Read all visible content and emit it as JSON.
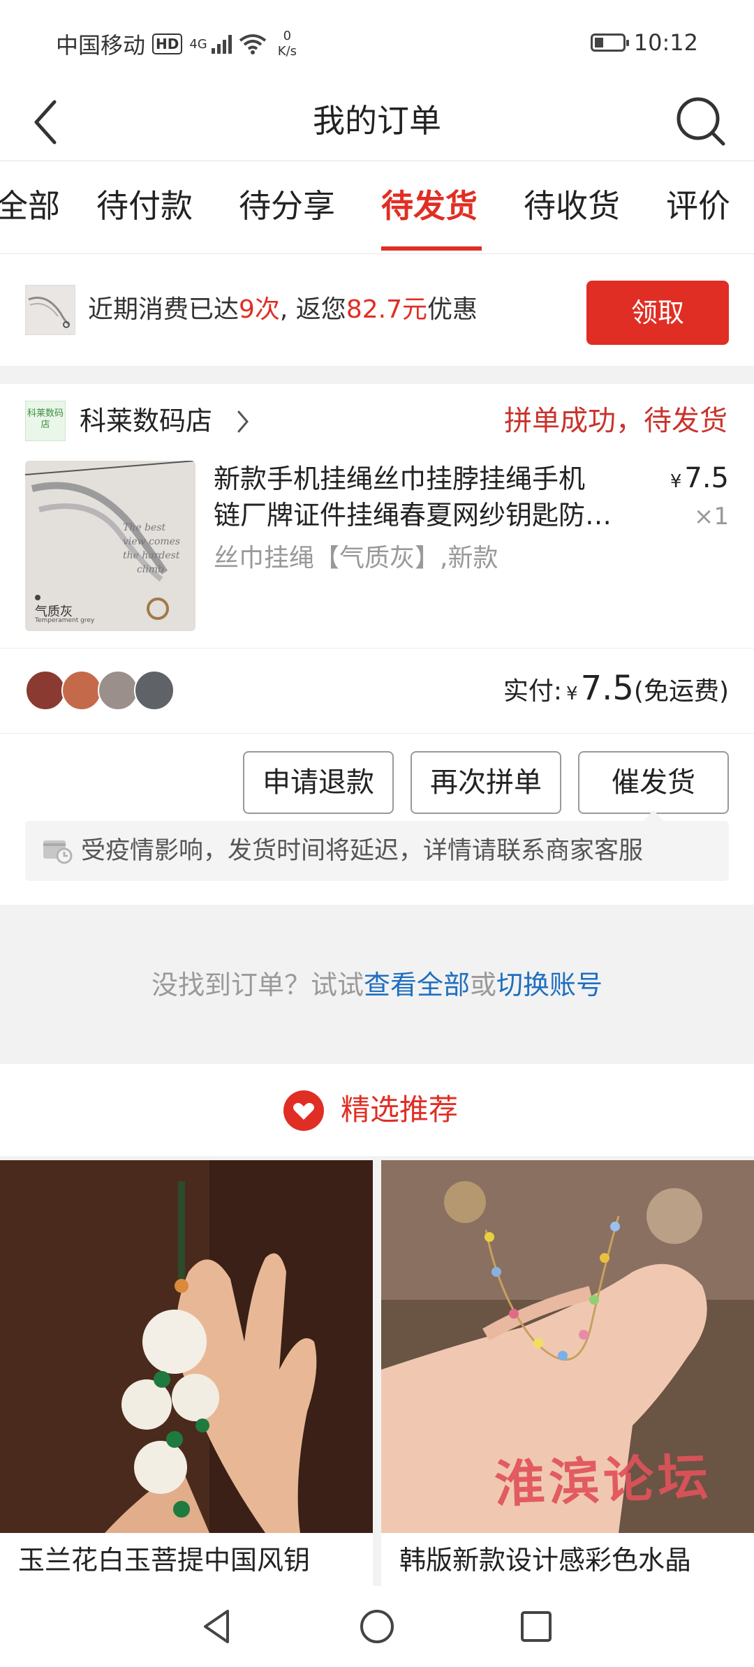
{
  "status_bar": {
    "carrier": "中国移动",
    "hd": "HD",
    "network": "4G",
    "speed_value": "0",
    "speed_unit": "K/s",
    "time": "10:12"
  },
  "header": {
    "title": "我的订单"
  },
  "tabs": [
    {
      "label": "全部",
      "active": false
    },
    {
      "label": "待付款",
      "active": false
    },
    {
      "label": "待分享",
      "active": false
    },
    {
      "label": "待发货",
      "active": true
    },
    {
      "label": "待收货",
      "active": false
    },
    {
      "label": "评价",
      "active": false
    }
  ],
  "promo": {
    "text_pre": "近期消费已达",
    "count": "9次",
    "text_mid": ", 返您",
    "amount": "82.7元",
    "text_post": "优惠",
    "button": "领取"
  },
  "order": {
    "shop_logo_text": "科莱数码店",
    "shop_name": "科莱数码店",
    "status": "拼单成功，待发货",
    "product_title_line1": "新款手机挂绳丝巾挂脖挂绳手机",
    "product_title_line2": "链厂牌证件挂绳春夏网纱钥匙防…",
    "product_image_caption": "气质灰",
    "product_image_caption_sub": "Temperament grey",
    "price_symbol": "¥",
    "price": "7.5",
    "quantity": "×1",
    "spec": "丝巾挂绳【气质灰】,新款",
    "paid_label": "实付:",
    "paid_symbol": "¥",
    "paid_amount": "7.5",
    "shipping_note": "(免运费)",
    "buttons": {
      "refund": "申请退款",
      "regroup": "再次拼单",
      "urge": "催发货"
    },
    "notice": "受疫情影响，发货时间将延迟，详情请联系商家客服"
  },
  "empty_tip": {
    "text_pre": "没找到订单？试试",
    "link_all": "查看全部",
    "text_mid": "或",
    "link_switch": "切换账号"
  },
  "recommend": {
    "title": "精选推荐",
    "items": [
      {
        "title": "玉兰花白玉菩提中国风钥"
      },
      {
        "title": "韩版新款设计感彩色水晶",
        "watermark": "淮滨论坛"
      }
    ]
  },
  "colors": {
    "accent": "#e02e24",
    "link": "#1e6fc0",
    "status": "#c8332b"
  }
}
